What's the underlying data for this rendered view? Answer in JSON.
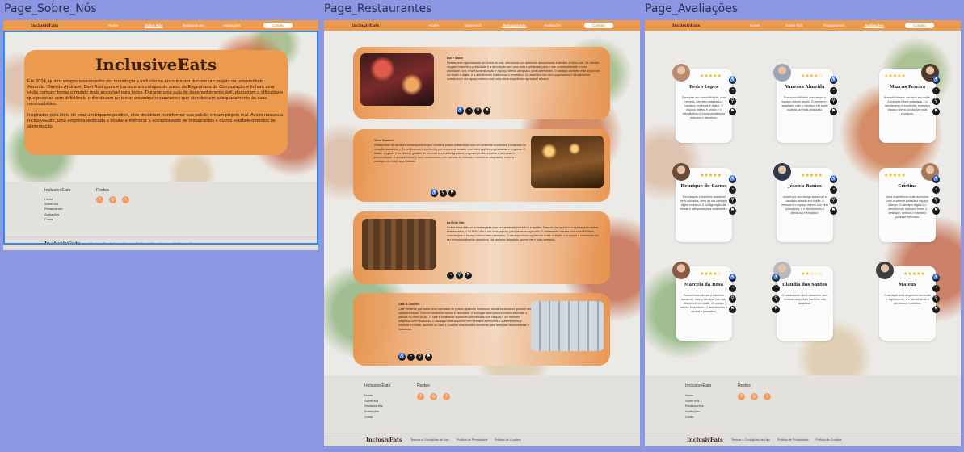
{
  "frames": {
    "sobre": "Page_Sobre_Nós",
    "restaurantes": "Page_Restaurantes",
    "avaliacoes": "Page_Avaliações"
  },
  "nav": {
    "logo": "InclusivEats",
    "items": [
      "Home",
      "Sobre Nós",
      "Restaurantes",
      "Avaliações"
    ],
    "contato": "Contato"
  },
  "about": {
    "title": "InclusiveEats",
    "p1": "Em 2024, quatro amigos apaixonados por tecnologia e inclusão se encontraram durante um projeto na universidade. Amanda, Davi de Andrade, Davi Rodrigues e Lucas eram colegas de curso de Engenharia de Computação e tinham uma visão comum: tornar o mundo mais acessível para todos. Durante uma aula de desenvolvimento ágil, discutiram a dificuldade que pessoas com deficiência enfrentavam ao tentar encontrar restaurantes que atendessem adequadamente às suas necessidades.",
    "p2": "Inspirados pela ideia de criar um impacto positivo, eles decidiram transformar sua paixão em um projeto real. Assim nasceu a InclusiveEats, uma empresa dedicada a avaliar e melhorar a acessibilidade de restaurantes e outros estabelecimentos de alimentação."
  },
  "footer": {
    "brand": "InclusiveEats",
    "links": [
      "Home",
      "Sobre nós",
      "Restaurantes",
      "Avaliações",
      "Conta"
    ],
    "redes": "Redes",
    "social": [
      "f",
      "◎",
      "t"
    ],
    "bar_logo": "InclusivEats",
    "bar_links": [
      "Termos e Condições de Uso",
      "Política de Privacidade",
      "Política de Cookies"
    ]
  },
  "restaurants": [
    {
      "name": "Bar e Sabor",
      "text": "Restaurante especializado em frutos do mar, oferecendo um ambiente descontraído e familiar à beira-mar. Os clientes elogiam bastante a praticidade e a decoração com uma vista espetacular para o mar. A acessibilidade é uma prioridade, com uma boa sinalização e espaço interno adequado para cadeirantes. O cardápio também está disponível em braile e digital, e a atendimento é atencioso e prestativo. Os assentos são bem organizados e há banheiros acessíveis e um espaço externo com uma ótima experiência agradável a todos."
    },
    {
      "name": "Terra Gourmet",
      "text": "Restaurante de cardápio contemporâneo que combina pratos sofisticados com um ambiente acolhedor. Localizado no coração da cidade, o Terra Gourmet é conhecido por seu menu variado, que inclui opções vegetarianas e veganas. O local é elegante e os clientes gostam de oferecer uma vista agradável, enquanto o atendimento é atencioso e personalizado. A acessibilidade é bem considerada, com rampas de entrada e banheiros adaptados, embora o cardápio em braile seja limitado."
    },
    {
      "name": "La Bella Vita",
      "text": "Restaurante italiano aconchegante com um ambiente romântico e familiar. Famoso por suas massas frescas e vinhos selecionados, o La Bella Vita é um local popular para jantares especiais. O restaurante oferece boa acessibilidade, com rampas e espaço interno bem planejado. O cardápio inclui opções em braile e digital, e a equipe é conhecida por ser excepcionalmente atenciosa. Há banheiro adaptado, porém ele é mais apertado."
    },
    {
      "name": "Café & Cozinha",
      "text": "Café moderno que serve uma variedade de pratos rápidos e deliciosos, desde sanduíches gourmet até saladas frescas. Com um ambiente casual e descolado, é um lugar ideal para encontros informais e pausas no meio do dia. O café é totalmente acessível com entrada com rampas e um banheiro adaptado bem sinalizado. O cardápio está disponível em formatos acessíveis e o atendimento é eficiente e cordial, fazendo do Café & Cozinha uma escolha excelente para refeições descontraídas e inclusivas."
    }
  ],
  "reviews": [
    {
      "name": "Pedro Lopes",
      "stars": "★★★★★",
      "text": "Exemplar em acessibilidade, com rampas, banheiro adaptado e cardápio em braile e digital. O espaço interno é amplo e o atendimento é excepcionalmente inclusivo e atencioso."
    },
    {
      "name": "Vanessa Almeida",
      "stars": "★★★★☆",
      "text": "Boa acessibilidade com rampa e espaço interno amplo. O banheiro é adaptado, mas o cardápio em braile poderia ser mais detalhado."
    },
    {
      "name": "Marcos Pereira",
      "stars": "★★★★★",
      "text": "Acessibilidade e cardápio em braille. A entrada é bem adaptada, e o atendimento é excelente, embora o espaço interno possa ser mais espaçoso."
    },
    {
      "name": "Henrique do Carmo",
      "stars": "★★★★★",
      "text": "Tem rampas e banheiro acessível bem cuidados, além de um cardápio digital inclusivo. A configuração das mesas é adequada para cadeirantes."
    },
    {
      "name": "Jéssica Ramos",
      "stars": "★★★★★",
      "text": "Adorei por seu design acessível e cardápio variado em braille. A entrada e o espaço interno são bem planejados, e o atendimento é atencioso e empático."
    },
    {
      "name": "Cristina",
      "stars": "★★★★★",
      "text": "Uma experiência muito acessível com excelente entrada e espaço interno. O cardápio digital e o atendimento inclusivo foram o destaque, embora o banheiro pudesse ser maior."
    },
    {
      "name": "Marcela da Rosa",
      "stars": "★★★★☆",
      "text": "Possui boas rampas e banheiro acessível, mas o cardápio não está disponível em braile. O espaço interno é razoável e o atendimento é cordial e prestativo."
    },
    {
      "name": "Claudia dos Santos",
      "stars": "★★☆☆☆",
      "text": "O restaurante não é acessível, sem entrada rampada e banheiro não adaptado."
    },
    {
      "name": "Mateus",
      "stars": "★★★★★",
      "text": "O cardápio está disponível em braile e digitalmente, e o atendimento é atencioso e inclusivo."
    }
  ],
  "access_icons": [
    "♿",
    "◔",
    "⚲",
    "⚑"
  ],
  "colors": {
    "accent": "#eb9a4e",
    "canvas": "#8b97e2",
    "selection": "#2d8cf0"
  }
}
